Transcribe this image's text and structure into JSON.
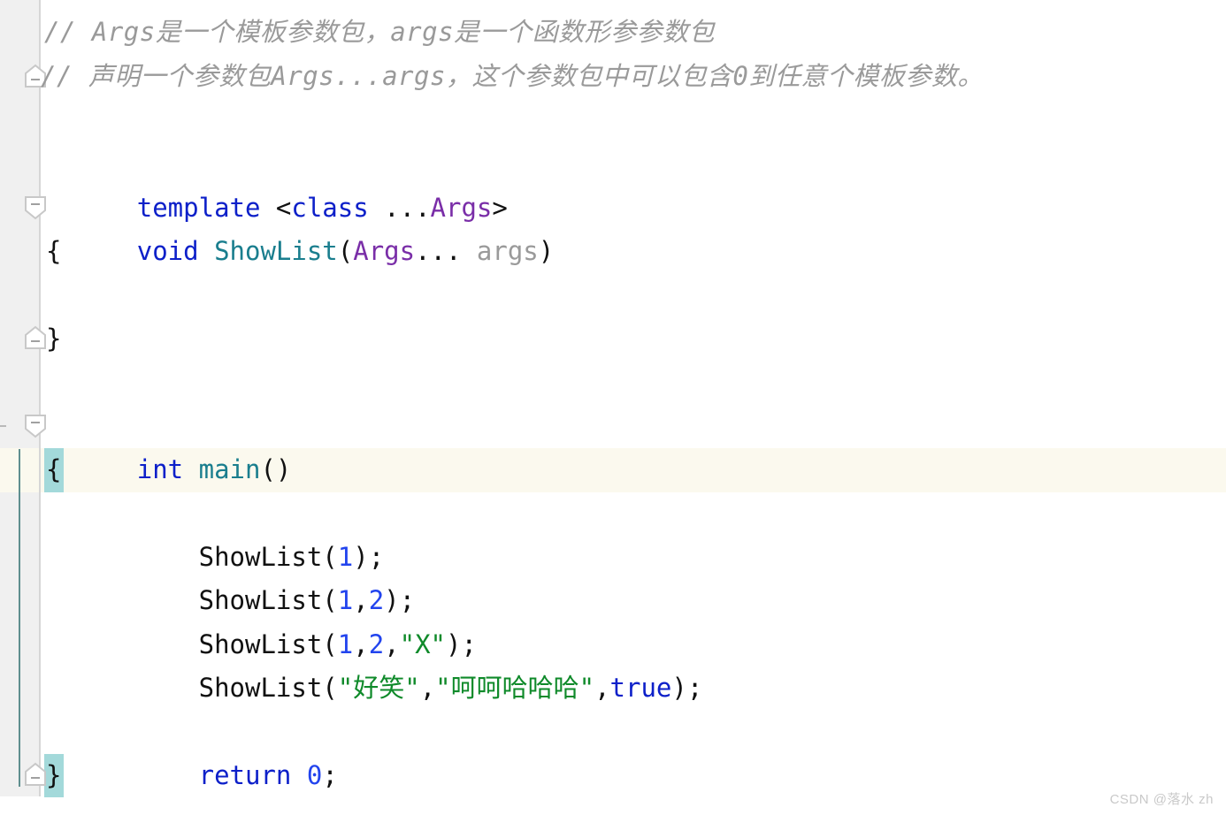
{
  "app": {
    "type": "code-editor",
    "language": "C++",
    "theme": "light"
  },
  "colors": {
    "editor_background": "#ffffff",
    "gutter_background": "#f0f0f0",
    "gutter_border": "#d6d6d6",
    "current_line_highlight": "#fbf9ee",
    "brace_match_highlight": "#a3d9da",
    "block_indent_guide": "#5f8f8f",
    "comment": "#9a9a9a",
    "keyword": "#0d20c9",
    "function_name": "#1a7e8e",
    "template_param": "#7a2ea8",
    "number": "#2244ee",
    "string": "#0f8a2a",
    "plain_text": "#111111",
    "unused_param": "#9a9a9a",
    "watermark": "#c9c9c9"
  },
  "comments": {
    "line1": "// Args是一个模板参数包，args是一个函数形参参数包",
    "line2": "// 声明一个参数包Args...args，这个参数包中可以包含0到任意个模板参数。"
  },
  "code": {
    "template_decl": {
      "kw_template": "template",
      "lt": " <",
      "kw_class": "class",
      "ellipsis": " ...",
      "args_type": "Args",
      "gt": ">"
    },
    "function_signature": {
      "kw_void": "void",
      "name": "ShowList",
      "open_paren": "(",
      "param_type": "Args",
      "param_ellipsis": "... ",
      "param_name": "args",
      "close_paren": ")"
    },
    "fn_open_brace": "{",
    "fn_close_brace": "}",
    "main_signature": {
      "kw_int": "int",
      "name": "main",
      "parens": "()"
    },
    "main_open_brace": "{",
    "main_close_brace": "}",
    "calls": [
      {
        "indent": "    ",
        "name": "ShowList",
        "open": "(",
        "args": [
          {
            "text": "1",
            "kind": "num"
          }
        ],
        "close": ");"
      },
      {
        "indent": "    ",
        "name": "ShowList",
        "open": "(",
        "args": [
          {
            "text": "1",
            "kind": "num"
          },
          {
            "text": "2",
            "kind": "num"
          }
        ],
        "close": ");"
      },
      {
        "indent": "    ",
        "name": "ShowList",
        "open": "(",
        "args": [
          {
            "text": "1",
            "kind": "num"
          },
          {
            "text": "2",
            "kind": "num"
          },
          {
            "text": "\"X\"",
            "kind": "str"
          }
        ],
        "close": ");"
      },
      {
        "indent": "    ",
        "name": "ShowList",
        "open": "(",
        "args": [
          {
            "text": "\"好笑\"",
            "kind": "str"
          },
          {
            "text": "\"呵呵哈哈哈\"",
            "kind": "str"
          },
          {
            "text": "true",
            "kind": "kw"
          }
        ],
        "close": ");"
      }
    ],
    "return_stmt": {
      "indent": "    ",
      "kw_return": "return",
      "value": "0",
      "semicolon": ";"
    }
  },
  "gutter": {
    "fold_markers": [
      {
        "name": "fold-comment-block",
        "direction": "up",
        "glyph": "−"
      },
      {
        "name": "fold-showlist-function",
        "direction": "down",
        "glyph": "−"
      },
      {
        "name": "fold-showlist-end",
        "direction": "up",
        "glyph": "−"
      },
      {
        "name": "fold-main-function",
        "direction": "down",
        "glyph": "−"
      },
      {
        "name": "fold-main-end",
        "direction": "up",
        "glyph": "−"
      }
    ]
  },
  "watermark": {
    "text": "CSDN @落水 zh"
  }
}
